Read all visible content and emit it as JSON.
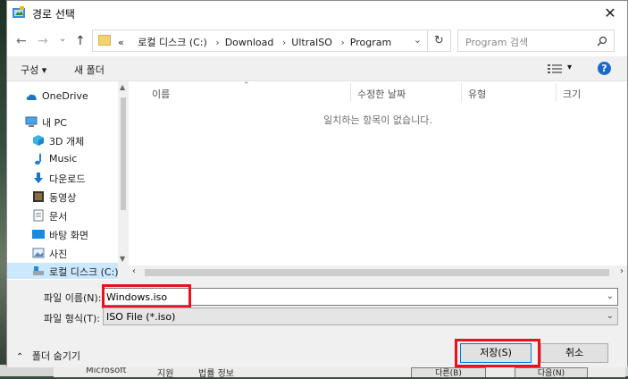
{
  "dialog": {
    "title": "경로 선택",
    "close_glyph": "✕"
  },
  "nav": {
    "back": "←",
    "forward": "→",
    "recent": "⌄",
    "up": "↑",
    "path_prefix": "«",
    "path": [
      "로컬 디스크 (C:)",
      "Download",
      "UltraISO",
      "Program"
    ],
    "path_separator": "›",
    "address_dropdown": "⌄",
    "refresh": "↻",
    "search_placeholder": "Program 검색"
  },
  "toolbar": {
    "organize": "구성 ▾",
    "new_folder": "새 폴더",
    "view": "▾",
    "help": "?"
  },
  "sidebar": {
    "items": [
      {
        "label": "OneDrive",
        "icon": "onedrive-icon"
      },
      {
        "label": "내 PC",
        "icon": "pc-icon"
      },
      {
        "label": "3D 개체",
        "icon": "3d-objects-icon"
      },
      {
        "label": "Music",
        "icon": "music-icon"
      },
      {
        "label": "다운로드",
        "icon": "download-icon"
      },
      {
        "label": "동영상",
        "icon": "video-icon"
      },
      {
        "label": "문서",
        "icon": "document-icon"
      },
      {
        "label": "바탕 화면",
        "icon": "desktop-icon"
      },
      {
        "label": "사진",
        "icon": "pictures-icon"
      },
      {
        "label": "로컬 디스크 (C:)",
        "icon": "drive-icon"
      }
    ]
  },
  "file_list": {
    "columns": [
      "이름",
      "수정한 날짜",
      "유형",
      "크기"
    ],
    "empty_message": "일치하는 항목이 없습니다."
  },
  "form": {
    "filename_label": "파일 이름(N):",
    "filename_value": "Windows.iso",
    "filetype_label": "파일 형식(T):",
    "filetype_value": "ISO File (*.iso)",
    "hide_folders": "폴더 숨기기",
    "save_label": "저장(S)",
    "cancel_label": "취소"
  },
  "background": {
    "texts": [
      "Microsoft",
      "지원",
      "법률 정보"
    ],
    "buttons": [
      "다른(B)",
      "다음(N)"
    ]
  },
  "colors": {
    "highlight": "#e8111d",
    "accent": "#0078d7",
    "selected_bg": "#cce8ff"
  }
}
